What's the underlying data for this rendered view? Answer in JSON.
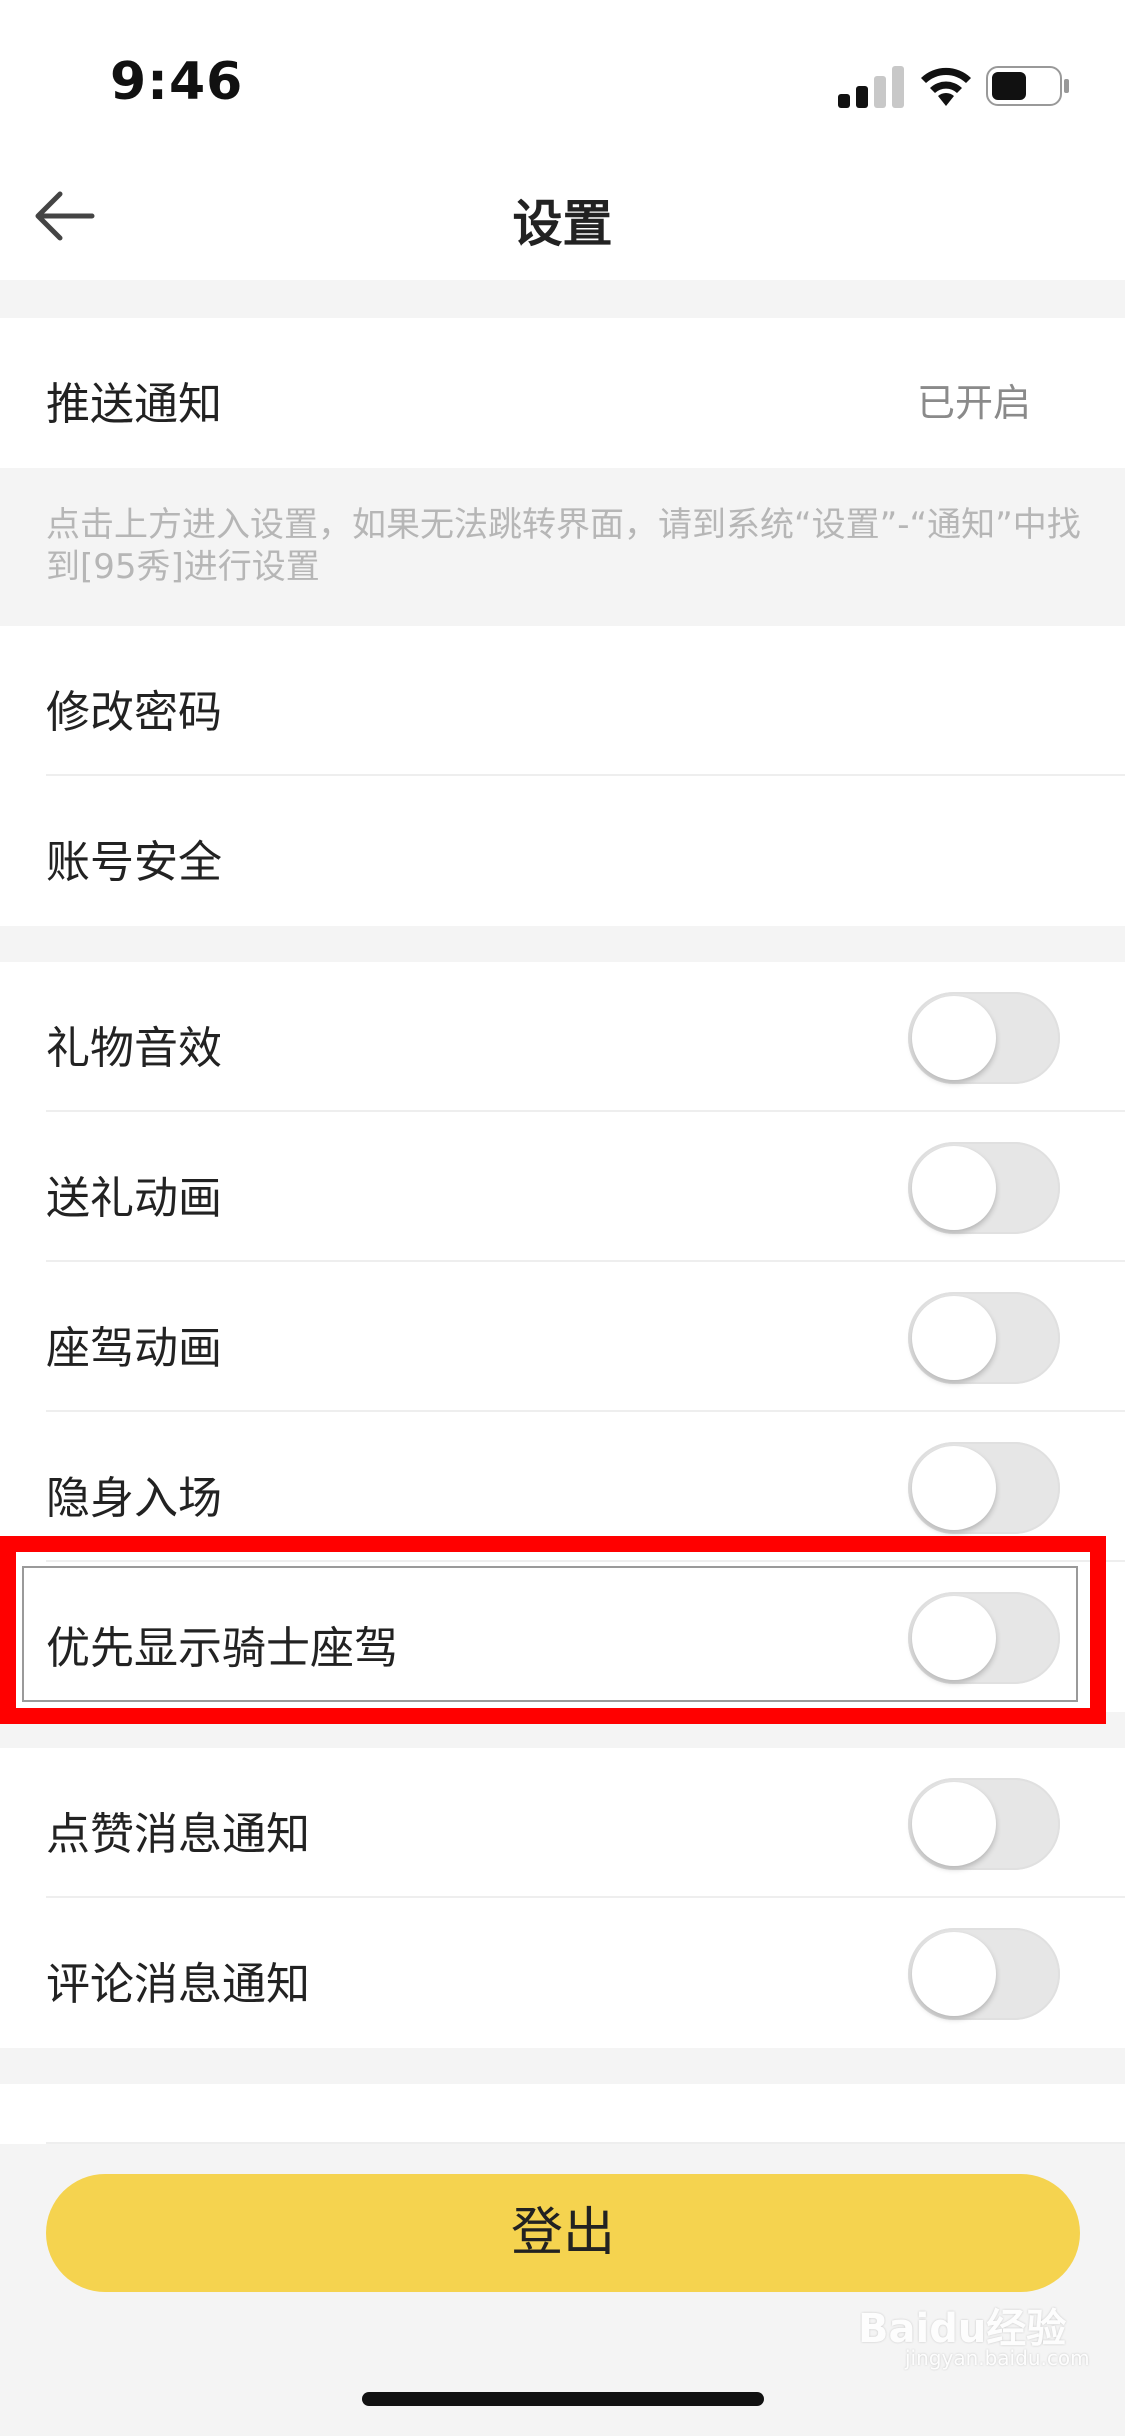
{
  "status_bar": {
    "time": "9:46"
  },
  "nav": {
    "title": "设置"
  },
  "push": {
    "label": "推送通知",
    "value": "已开启"
  },
  "hint": "点击上方进入设置，如果无法跳转界面，请到系统“设置”-“通知”中找到[95秀]进行设置",
  "account": [
    {
      "label": "修改密码"
    },
    {
      "label": "账号安全"
    }
  ],
  "toggles": [
    {
      "label": "礼物音效",
      "on": false
    },
    {
      "label": "送礼动画",
      "on": false
    },
    {
      "label": "座驾动画",
      "on": false
    },
    {
      "label": "隐身入场",
      "on": false
    },
    {
      "label": "优先显示骑士座驾",
      "on": false
    },
    {
      "label": "点赞消息通知",
      "on": false
    },
    {
      "label": "评论消息通知",
      "on": false
    }
  ],
  "logout_label": "登出",
  "watermark": {
    "brand": "Baidu经验",
    "sub": "jingyan.baidu.com"
  },
  "colors": {
    "accent": "#f5d34f",
    "highlight": "#ff0000"
  },
  "icons": {
    "back": "arrow-left-icon",
    "signal": "cellular-signal-icon",
    "wifi": "wifi-icon",
    "battery": "battery-icon"
  }
}
